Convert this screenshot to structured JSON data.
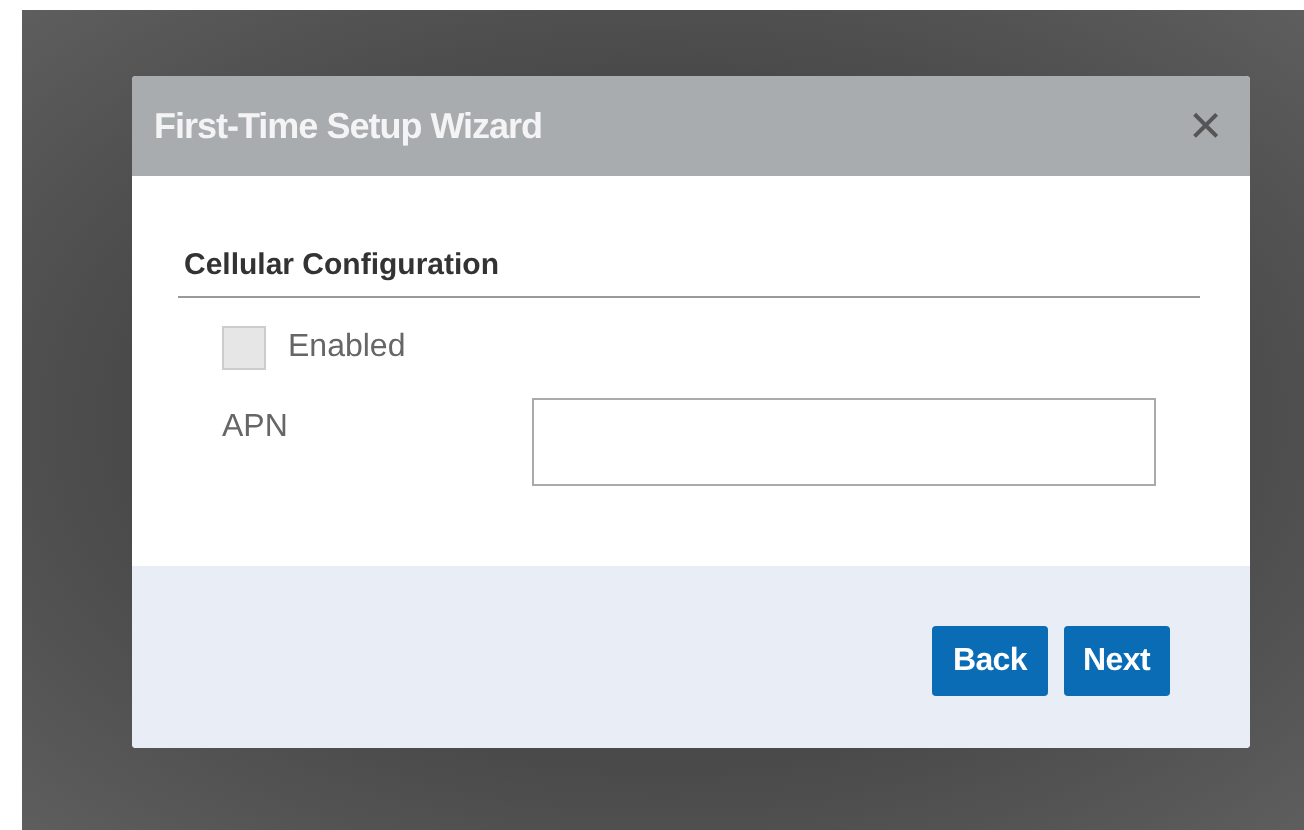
{
  "dialog": {
    "title": "First-Time Setup Wizard",
    "close": "×"
  },
  "section": {
    "title": "Cellular Configuration"
  },
  "checkbox": {
    "label": "Enabled",
    "checked": false,
    "disabled": true
  },
  "field": {
    "label": "APN"
  },
  "buttons": [
    "Back",
    "Next"
  ]
}
